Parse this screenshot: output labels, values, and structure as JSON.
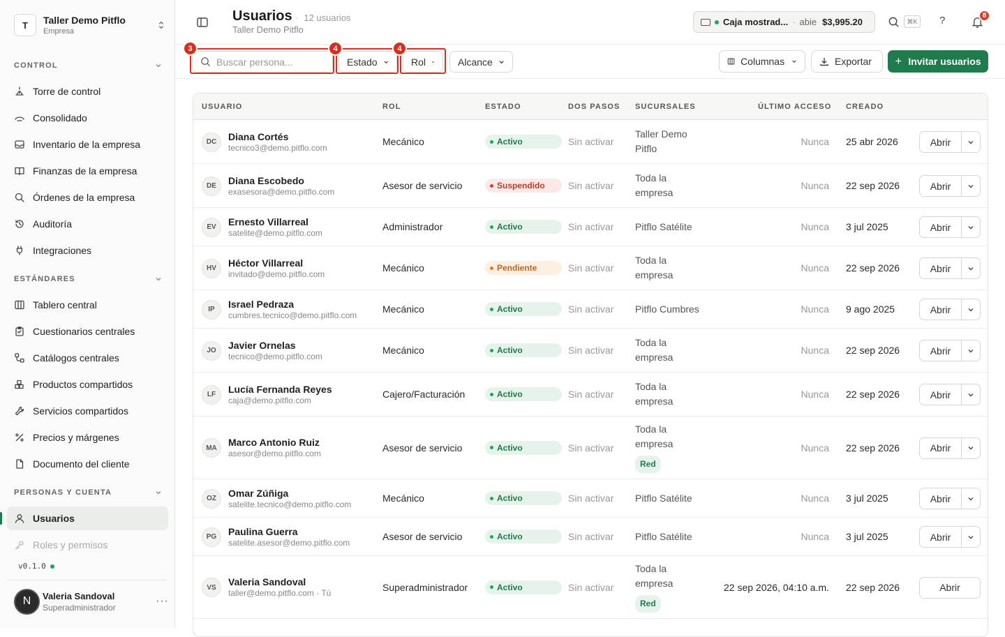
{
  "sidebar": {
    "org": {
      "initial": "T",
      "name": "Taller Demo Pitflo",
      "type": "Empresa"
    },
    "sections": [
      {
        "title": "CONTROL",
        "items": [
          {
            "label": "Torre de control",
            "icon": "target-icon"
          },
          {
            "label": "Consolidado",
            "icon": "layers-icon"
          },
          {
            "label": "Inventario de la empresa",
            "icon": "inbox-icon"
          },
          {
            "label": "Finanzas de la empresa",
            "icon": "book-icon"
          },
          {
            "label": "Órdenes de la empresa",
            "icon": "search-icon"
          },
          {
            "label": "Auditoría",
            "icon": "history-icon"
          },
          {
            "label": "Integraciones",
            "icon": "plug-icon"
          }
        ]
      },
      {
        "title": "ESTÁNDARES",
        "items": [
          {
            "label": "Tablero central",
            "icon": "columns-icon"
          },
          {
            "label": "Cuestionarios centrales",
            "icon": "clipboard-icon"
          },
          {
            "label": "Catálogos centrales",
            "icon": "workflow-icon"
          },
          {
            "label": "Productos compartidos",
            "icon": "boxes-icon"
          },
          {
            "label": "Servicios compartidos",
            "icon": "wrench-icon"
          },
          {
            "label": "Precios y márgenes",
            "icon": "percent-icon"
          },
          {
            "label": "Documento del cliente",
            "icon": "file-icon"
          }
        ]
      },
      {
        "title": "PERSONAS Y CUENTA",
        "items": [
          {
            "label": "Usuarios",
            "icon": "user-icon",
            "active": true
          },
          {
            "label": "Roles y permisos",
            "icon": "key-icon"
          }
        ]
      }
    ],
    "version": "v0.1.0",
    "user": {
      "initial": "N",
      "name": "Valeria Sandoval",
      "role": "Superadministrador",
      "menu": "···"
    }
  },
  "header": {
    "title": "Usuarios",
    "count": "12 usuarios",
    "subtitle": "Taller Demo Pitflo",
    "cash": {
      "name": "Caja mostrad...",
      "state": "abie",
      "amount": "$3,995.20"
    },
    "shortcut": "⌘K",
    "help": "?",
    "notifications": "8"
  },
  "toolbar": {
    "search_placeholder": "Buscar persona...",
    "filters": [
      "Estado",
      "Rol",
      "Alcance"
    ],
    "columns_label": "Columnas",
    "export_label": "Exportar",
    "invite_label": "Invitar usuarios",
    "highlights": [
      "3",
      "4",
      "4"
    ]
  },
  "table": {
    "headers": [
      "USUARIO",
      "ROL",
      "ESTADO",
      "DOS PASOS",
      "SUCURSALES",
      "ÚLTIMO ACCESO",
      "CREADO"
    ],
    "open_label": "Abrir",
    "rows": [
      {
        "initials": "DC",
        "name": "Diana Cortés",
        "email": "tecnico3@demo.pitflo.com",
        "role": "Mecánico",
        "status": "Activo",
        "status_kind": "ok",
        "two_step": "Sin activar",
        "branch": [
          "Taller Demo",
          "Pitflo"
        ],
        "tag": "",
        "access": "Nunca",
        "created": "25 abr 2026"
      },
      {
        "initials": "DE",
        "name": "Diana Escobedo",
        "email": "exasesora@demo.pitflo.com",
        "role": "Asesor de servicio",
        "status": "Suspendido",
        "status_kind": "sus",
        "two_step": "Sin activar",
        "branch": [
          "Toda la",
          "empresa"
        ],
        "tag": "",
        "access": "Nunca",
        "created": "22 sep 2026"
      },
      {
        "initials": "EV",
        "name": "Ernesto Villarreal",
        "email": "satelite@demo.pitflo.com",
        "role": "Administrador",
        "status": "Activo",
        "status_kind": "ok",
        "two_step": "Sin activar",
        "branch": [
          "Pitflo Satélite"
        ],
        "tag": "",
        "access": "Nunca",
        "created": "3 jul 2025"
      },
      {
        "initials": "HV",
        "name": "Héctor Villarreal",
        "email": "invitado@demo.pitflo.com",
        "role": "Mecánico",
        "status": "Pendiente",
        "status_kind": "pen",
        "two_step": "Sin activar",
        "branch": [
          "Toda la",
          "empresa"
        ],
        "tag": "",
        "access": "Nunca",
        "created": "22 sep 2026"
      },
      {
        "initials": "IP",
        "name": "Israel Pedraza",
        "email": "cumbres.tecnico@demo.pitflo.com",
        "role": "Mecánico",
        "status": "Activo",
        "status_kind": "ok",
        "two_step": "Sin activar",
        "branch": [
          "Pitflo Cumbres"
        ],
        "tag": "",
        "access": "Nunca",
        "created": "9 ago 2025"
      },
      {
        "initials": "JO",
        "name": "Javier Ornelas",
        "email": "tecnico@demo.pitflo.com",
        "role": "Mecánico",
        "status": "Activo",
        "status_kind": "ok",
        "two_step": "Sin activar",
        "branch": [
          "Toda la",
          "empresa"
        ],
        "tag": "",
        "access": "Nunca",
        "created": "22 sep 2026"
      },
      {
        "initials": "LF",
        "name": "Lucía Fernanda Reyes",
        "email": "caja@demo.pitflo.com",
        "role": "Cajero/Facturación",
        "status": "Activo",
        "status_kind": "ok",
        "two_step": "Sin activar",
        "branch": [
          "Toda la",
          "empresa"
        ],
        "tag": "",
        "access": "Nunca",
        "created": "22 sep 2026"
      },
      {
        "initials": "MA",
        "name": "Marco Antonio Ruiz",
        "email": "asesor@demo.pitflo.com",
        "role": "Asesor de servicio",
        "status": "Activo",
        "status_kind": "ok",
        "two_step": "Sin activar",
        "branch": [
          "Toda la",
          "empresa"
        ],
        "tag": "Red",
        "access": "Nunca",
        "created": "22 sep 2026"
      },
      {
        "initials": "OZ",
        "name": "Omar Zúñiga",
        "email": "satelite.tecnico@demo.pitflo.com",
        "role": "Mecánico",
        "status": "Activo",
        "status_kind": "ok",
        "two_step": "Sin activar",
        "branch": [
          "Pitflo Satélite"
        ],
        "tag": "",
        "access": "Nunca",
        "created": "3 jul 2025"
      },
      {
        "initials": "PG",
        "name": "Paulina Guerra",
        "email": "satelite.asesor@demo.pitflo.com",
        "role": "Asesor de servicio",
        "status": "Activo",
        "status_kind": "ok",
        "two_step": "Sin activar",
        "branch": [
          "Pitflo Satélite"
        ],
        "tag": "",
        "access": "Nunca",
        "created": "3 jul 2025"
      },
      {
        "initials": "VS",
        "name": "Valeria Sandoval",
        "email": "taller@demo.pitflo.com · Tú",
        "role": "Superadministrador",
        "status": "Activo",
        "status_kind": "ok",
        "two_step": "Sin activar",
        "branch": [
          "Toda la",
          "empresa"
        ],
        "tag": "Red",
        "access": "22 sep 2026, 04:10 a.m.",
        "created": "22 sep 2026",
        "single_open": true
      }
    ]
  }
}
